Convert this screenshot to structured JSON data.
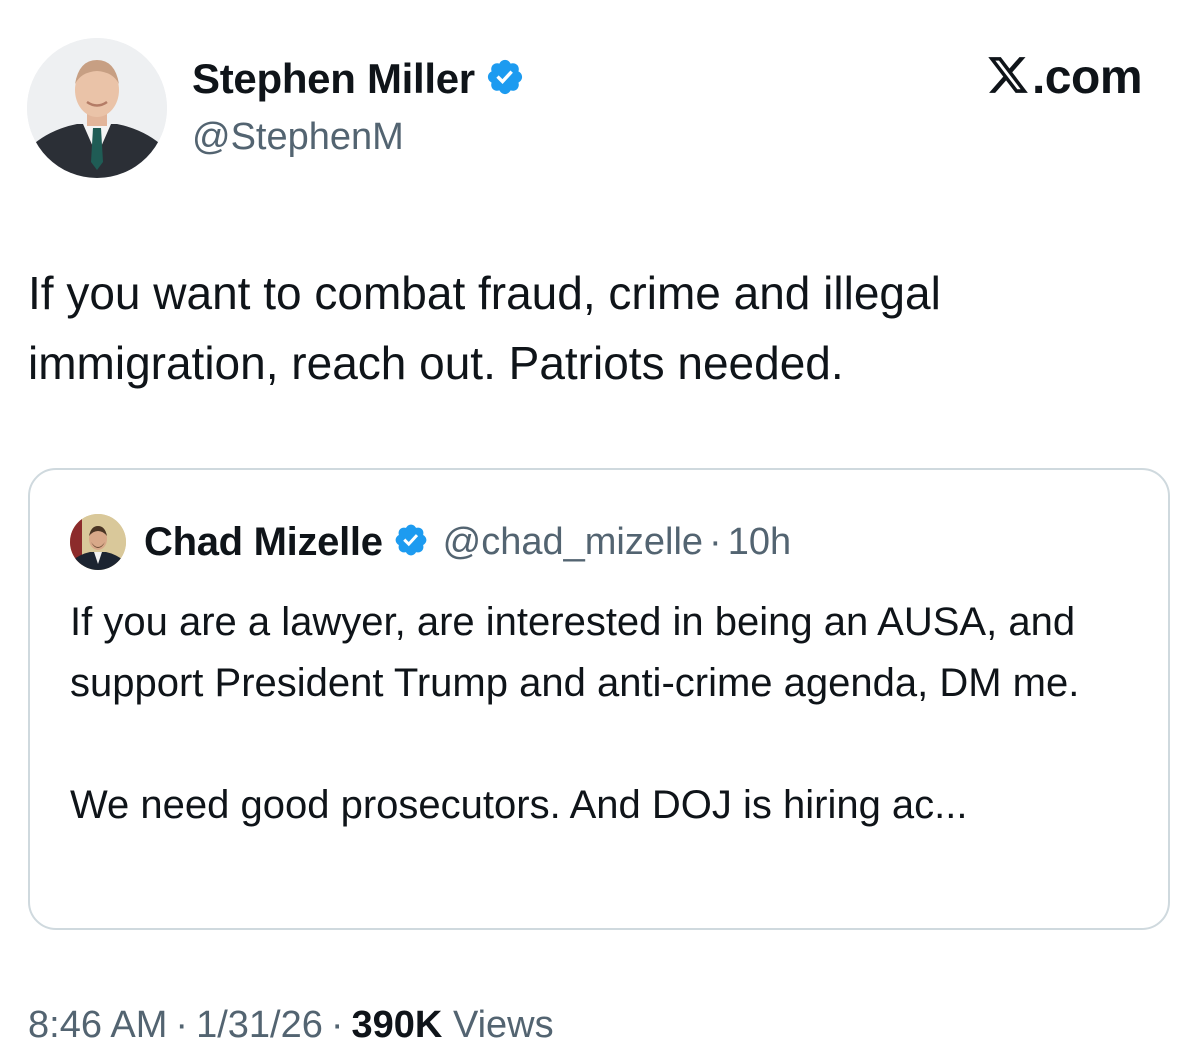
{
  "author": {
    "name": "Stephen Miller",
    "handle": "@StephenM",
    "avatar_icon": "profile-photo-man-suit",
    "verified": true
  },
  "brand": {
    "text": ".com",
    "logo_icon": "x-logo-icon"
  },
  "tweet": {
    "text": "If you want to combat fraud, crime and illegal immigration, reach out. Patriots needed."
  },
  "quote": {
    "name": "Chad Mizelle",
    "handle": "@chad_mizelle",
    "separator": "·",
    "time": "10h",
    "verified": true,
    "paragraph1": "If you are a lawyer, are interested in being an AUSA, and support President Trump and anti-crime agenda, DM me.",
    "paragraph2": "We need good prosecutors. And DOJ is hiring ac..."
  },
  "meta": {
    "time": "8:46 AM",
    "separator": "·",
    "date": "1/31/26",
    "views_count": "390K",
    "views_label": "Views"
  },
  "colors": {
    "verified_blue": "#1d9bf0",
    "text_primary": "#0f1419",
    "text_secondary": "#536471",
    "card_border": "#cfd9de"
  }
}
